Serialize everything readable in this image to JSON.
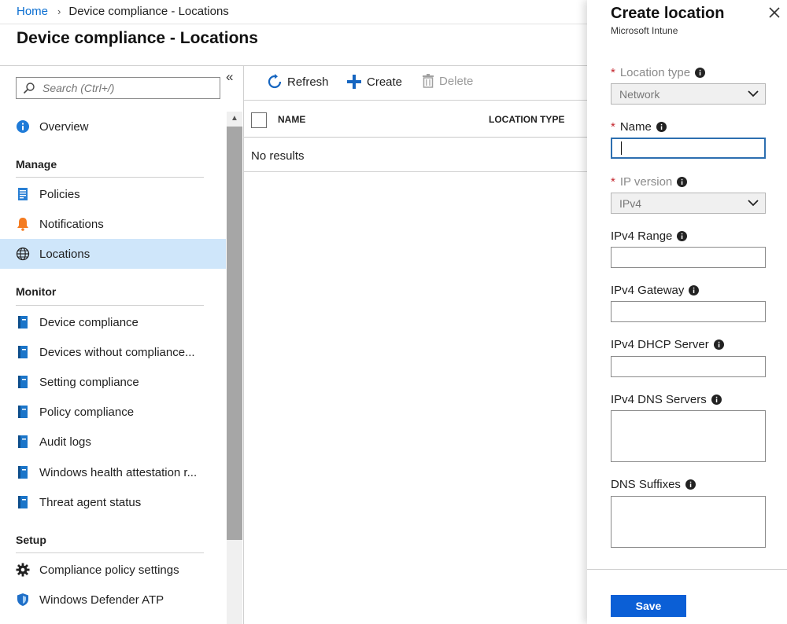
{
  "breadcrumb": {
    "home": "Home",
    "separator": "›",
    "current": "Device compliance - Locations"
  },
  "page_title": "Device compliance - Locations",
  "sidebar": {
    "search_placeholder": "Search (Ctrl+/)",
    "collapse_glyph": "«",
    "scroll_up_glyph": "▲",
    "overview": "Overview",
    "sections": {
      "manage": "Manage",
      "monitor": "Monitor",
      "setup": "Setup"
    },
    "manage_items": [
      "Policies",
      "Notifications",
      "Locations"
    ],
    "monitor_items": [
      "Device compliance",
      "Devices without compliance...",
      "Setting compliance",
      "Policy compliance",
      "Audit logs",
      "Windows health attestation r...",
      "Threat agent status"
    ],
    "setup_items": [
      "Compliance policy settings",
      "Windows Defender ATP"
    ],
    "active_item": "Locations"
  },
  "toolbar": {
    "refresh": "Refresh",
    "create": "Create",
    "delete": "Delete"
  },
  "table": {
    "columns": [
      "NAME",
      "LOCATION TYPE"
    ],
    "empty_message": "No results"
  },
  "panel": {
    "title": "Create location",
    "subtitle": "Microsoft Intune",
    "location_type_label": "Location type",
    "location_type_value": "Network",
    "name_label": "Name",
    "name_value": "",
    "ip_version_label": "IP version",
    "ip_version_value": "IPv4",
    "ipv4_range_label": "IPv4 Range",
    "ipv4_gateway_label": "IPv4 Gateway",
    "ipv4_dhcp_label": "IPv4 DHCP Server",
    "ipv4_dns_label": "IPv4 DNS Servers",
    "dns_suffixes_label": "DNS Suffixes",
    "required_marker": "*",
    "save": "Save"
  },
  "colors": {
    "accent": "#0b5fd6",
    "link": "#0a6ed1",
    "active_nav": "#cfe6fa",
    "required": "#c4262e"
  }
}
